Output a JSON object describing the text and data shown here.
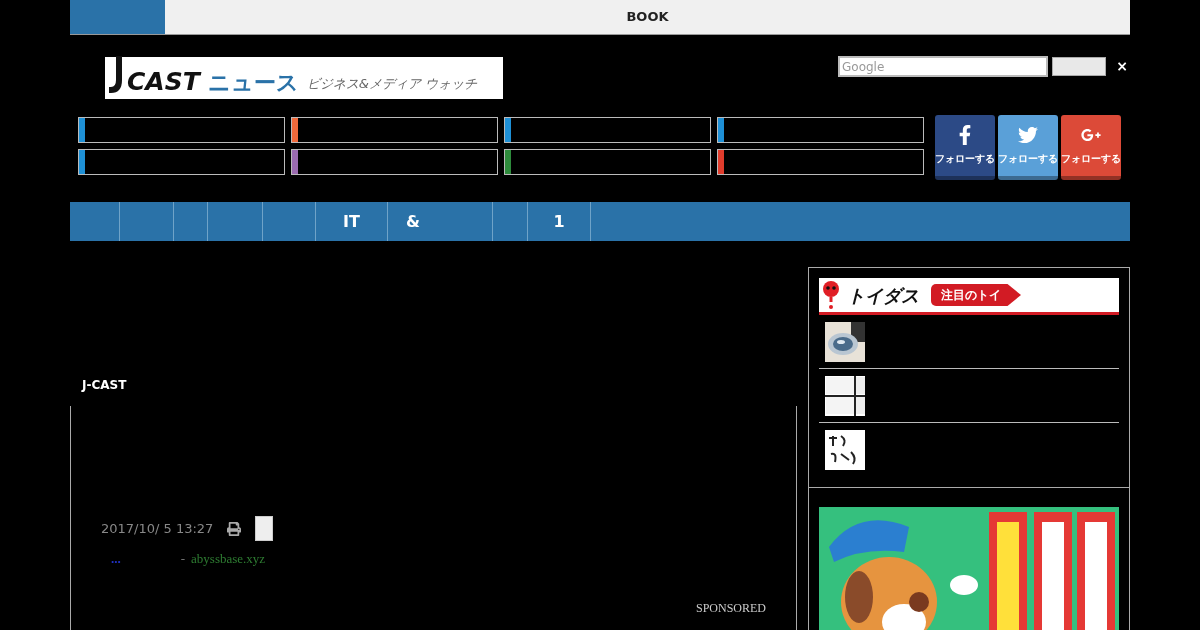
{
  "top_bar": {
    "title": "BOOK"
  },
  "logo": {
    "mark": "CAST",
    "name": "ニュース",
    "tagline": "ビジネス&メディア ウォッチ"
  },
  "search": {
    "placeholder": "Google",
    "close": "×"
  },
  "categories": [
    {
      "color": "#1e90d6"
    },
    {
      "color": "#f06a3c"
    },
    {
      "color": "#1e90d6"
    },
    {
      "color": "#1e90d6"
    },
    {
      "color": "#1e90d6"
    },
    {
      "color": "#9b6bb0"
    },
    {
      "color": "#2e8b3c"
    },
    {
      "color": "#e03c2c"
    }
  ],
  "social": [
    {
      "kind": "facebook",
      "label": "フォローする"
    },
    {
      "kind": "twitter",
      "label": "フォローする"
    },
    {
      "kind": "google",
      "label": "フォローする"
    }
  ],
  "nav": [
    {
      "label": "IT"
    },
    {
      "label": "&"
    },
    {
      "label": "1"
    }
  ],
  "article": {
    "section": "J-CAST",
    "date": "2017/10/ 5 13:27",
    "more": "...",
    "separator": "-",
    "source": "abyssbase.xyz",
    "sponsored": "SPONSORED"
  },
  "sidebar": {
    "brand": "トイダス",
    "badge": "注目のトイ"
  }
}
